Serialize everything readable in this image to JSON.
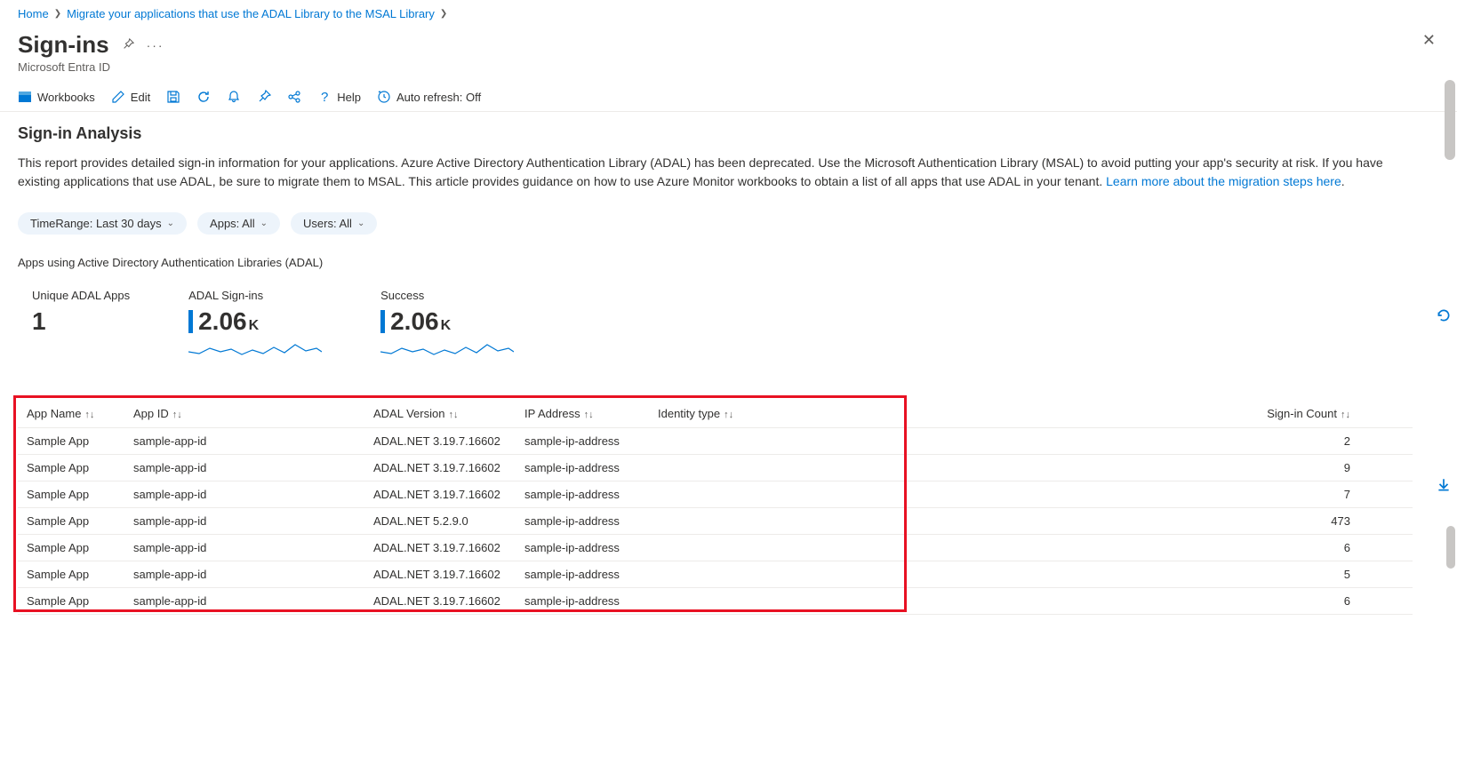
{
  "breadcrumb": {
    "items": [
      "Home",
      "Migrate your applications that use the ADAL Library to the MSAL Library"
    ]
  },
  "header": {
    "title": "Sign-ins",
    "subtitle": "Microsoft Entra ID"
  },
  "toolbar": {
    "workbooks": "Workbooks",
    "edit": "Edit",
    "help": "Help",
    "auto_refresh": "Auto refresh: Off"
  },
  "section": {
    "title": "Sign-in Analysis",
    "description_1": "This report provides detailed sign-in information for your applications. Azure Active Directory Authentication Library (ADAL) has been deprecated. Use the Microsoft Authentication Library (MSAL) to avoid putting your app's security at risk. If you have existing applications that use ADAL, be sure to migrate them to MSAL. This article provides guidance on how to use Azure Monitor workbooks to obtain a list of all apps that use ADAL in your tenant. ",
    "learn_more": "Learn more about the migration steps here",
    "period": "."
  },
  "filters": {
    "timerange": "TimeRange: Last 30 days",
    "apps": "Apps: All",
    "users": "Users: All"
  },
  "subsection_label": "Apps using Active Directory Authentication Libraries (ADAL)",
  "metrics": [
    {
      "label": "Unique ADAL Apps",
      "value": "1",
      "unit": "",
      "accent": false,
      "spark": false
    },
    {
      "label": "ADAL Sign-ins",
      "value": "2.06",
      "unit": "K",
      "accent": true,
      "spark": true
    },
    {
      "label": "Success",
      "value": "2.06",
      "unit": "K",
      "accent": true,
      "spark": true
    }
  ],
  "table": {
    "columns": [
      "App Name",
      "App ID",
      "ADAL Version",
      "IP Address",
      "Identity type",
      "Sign-in Count"
    ],
    "rows": [
      {
        "app": "Sample App",
        "id": "sample-app-id",
        "ver": "ADAL.NET 3.19.7.16602",
        "ip": "sample-ip-address",
        "idt": "",
        "count": "2"
      },
      {
        "app": "Sample App",
        "id": "sample-app-id",
        "ver": "ADAL.NET 3.19.7.16602",
        "ip": "sample-ip-address",
        "idt": "",
        "count": "9"
      },
      {
        "app": "Sample App",
        "id": "sample-app-id",
        "ver": "ADAL.NET 3.19.7.16602",
        "ip": "sample-ip-address",
        "idt": "",
        "count": "7"
      },
      {
        "app": "Sample App",
        "id": "sample-app-id",
        "ver": "ADAL.NET 5.2.9.0",
        "ip": "sample-ip-address",
        "idt": "",
        "count": "473"
      },
      {
        "app": "Sample App",
        "id": "sample-app-id",
        "ver": "ADAL.NET 3.19.7.16602",
        "ip": "sample-ip-address",
        "idt": "",
        "count": "6"
      },
      {
        "app": "Sample App",
        "id": "sample-app-id",
        "ver": "ADAL.NET 3.19.7.16602",
        "ip": "sample-ip-address",
        "idt": "",
        "count": "5"
      },
      {
        "app": "Sample App",
        "id": "sample-app-id",
        "ver": "ADAL.NET 3.19.7.16602",
        "ip": "sample-ip-address",
        "idt": "",
        "count": "6"
      }
    ]
  }
}
